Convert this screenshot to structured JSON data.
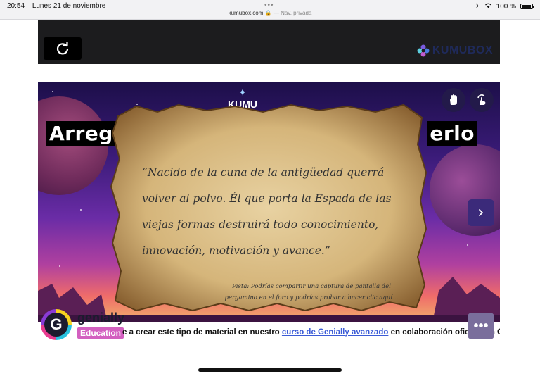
{
  "status": {
    "time": "20:54",
    "date": "Lunes 21 de noviembre",
    "battery": "100 %",
    "url": "kumubox.com",
    "mode": "— Nav. privada"
  },
  "toolbar": {
    "brand": "KUMUBOX"
  },
  "scene": {
    "logo": "KUMU",
    "headline_left": "Arreg",
    "headline_right": "erlo",
    "quote": "“Nacido de la cuna de la antigüedad querrá volver al polvo. Él que porta la Espada de las viejas formas destruirá todo conocimiento, innovación, motivación y avance.”",
    "hint": "Pista: Podrías compartir una captura de pantalla del pergamino en el foro y podrías probar a hacer clic aquí…"
  },
  "banner": {
    "genially": "genially",
    "edu": "Education",
    "text_before": "e a crear este tipo de material en nuestro ",
    "link": "curso de Genially avanzado",
    "text_after": " en colaboración oficial con Genially"
  },
  "colors": {
    "accent_link": "#3b5bd6",
    "edu_badge": "#d35fc0",
    "toolbar_bg": "#1c1c1e"
  }
}
